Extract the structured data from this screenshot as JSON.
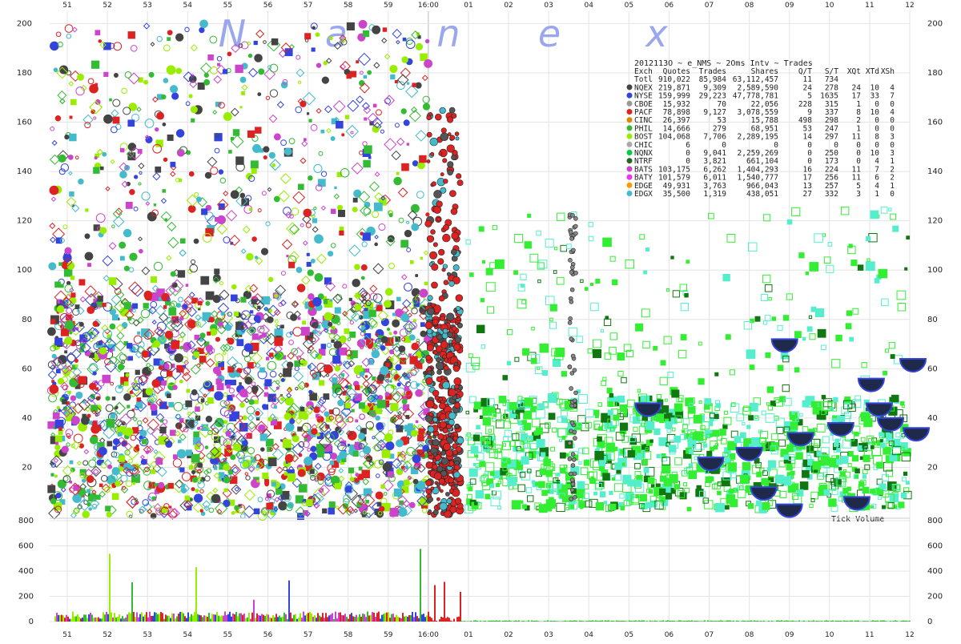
{
  "watermark": [
    "N",
    "a",
    "n",
    "e",
    "x"
  ],
  "chart_data": {
    "type": "scatter",
    "title": "2012113O ~ e_NMS ~ 2Oms Intv ~ Trades",
    "x_ticks": [
      "51",
      "52",
      "53",
      "54",
      "55",
      "56",
      "57",
      "58",
      "59",
      "16:00",
      "01",
      "02",
      "03",
      "04",
      "05",
      "06",
      "07",
      "08",
      "09",
      "10",
      "11",
      "12"
    ],
    "main_panel": {
      "y_ticks": [
        20,
        40,
        60,
        80,
        100,
        120,
        140,
        160,
        180,
        200
      ],
      "ylim": [
        0,
        205
      ],
      "grid": true
    },
    "volume_panel": {
      "label": "Tick Volume",
      "y_ticks": [
        0,
        200,
        400,
        600,
        800
      ],
      "ylim": [
        0,
        800
      ]
    },
    "table": {
      "columns": [
        "Exch",
        "Quotes",
        "Trades",
        "Shares",
        "Q/T",
        "S/T",
        "XQt",
        "XTd",
        "XSh"
      ],
      "rows": [
        {
          "exch": "Totl",
          "color": "",
          "cells": [
            "910,022",
            "85,984",
            "63,112,457",
            "11",
            "734",
            "",
            "",
            ""
          ]
        },
        {
          "exch": "NQEX",
          "color": "#444444",
          "cells": [
            "219,871",
            "9,309",
            "2,589,590",
            "24",
            "278",
            "24",
            "10",
            "4"
          ]
        },
        {
          "exch": "NYSE",
          "color": "#3344dd",
          "cells": [
            "159,999",
            "29,223",
            "47,778,781",
            "5",
            "1635",
            "17",
            "33",
            "7"
          ]
        },
        {
          "exch": "CBOE",
          "color": "#999999",
          "cells": [
            "15,932",
            "70",
            "22,056",
            "228",
            "315",
            "1",
            "0",
            "0"
          ]
        },
        {
          "exch": "PACF",
          "color": "#dd2222",
          "cells": [
            "78,898",
            "9,127",
            "3,078,559",
            "9",
            "337",
            "8",
            "10",
            "4"
          ]
        },
        {
          "exch": "CINC",
          "color": "#dd8800",
          "cells": [
            "26,397",
            "53",
            "15,788",
            "498",
            "298",
            "2",
            "0",
            "0"
          ]
        },
        {
          "exch": "PHIL",
          "color": "#33bb33",
          "cells": [
            "14,666",
            "279",
            "68,951",
            "53",
            "247",
            "1",
            "0",
            "0"
          ]
        },
        {
          "exch": "BOST",
          "color": "#99ee00",
          "cells": [
            "104,068",
            "7,706",
            "2,289,195",
            "14",
            "297",
            "11",
            "8",
            "3"
          ]
        },
        {
          "exch": "CHIC",
          "color": "#aaaaaa",
          "cells": [
            "6",
            "0",
            "0",
            "0",
            "0",
            "0",
            "0",
            "0"
          ]
        },
        {
          "exch": "NQNX",
          "color": "#00cc44",
          "cells": [
            "0",
            "9,041",
            "2,259,269",
            "0",
            "250",
            "0",
            "10",
            "3"
          ]
        },
        {
          "exch": "NTRF",
          "color": "#226622",
          "cells": [
            "0",
            "3,821",
            "661,104",
            "0",
            "173",
            "0",
            "4",
            "1"
          ]
        },
        {
          "exch": "BATS",
          "color": "#cc44cc",
          "cells": [
            "103,175",
            "6,262",
            "1,404,293",
            "16",
            "224",
            "11",
            "7",
            "2"
          ]
        },
        {
          "exch": "BATY",
          "color": "#ee33ee",
          "cells": [
            "101,579",
            "6,011",
            "1,540,777",
            "17",
            "256",
            "11",
            "6",
            "2"
          ]
        },
        {
          "exch": "EDGE",
          "color": "#ff9900",
          "cells": [
            "49,931",
            "3,763",
            "966,043",
            "13",
            "257",
            "5",
            "4",
            "1"
          ]
        },
        {
          "exch": "EDGX",
          "color": "#44bbcc",
          "cells": [
            "35,500",
            "1,319",
            "438,051",
            "27",
            "332",
            "3",
            "1",
            "0"
          ]
        }
      ]
    },
    "series_colors": [
      "#3344dd",
      "#dd2222",
      "#99ee00",
      "#33bb33",
      "#cc44cc",
      "#444444",
      "#44bbcc",
      "#00cc44",
      "#66ffcc",
      "#999999"
    ]
  }
}
